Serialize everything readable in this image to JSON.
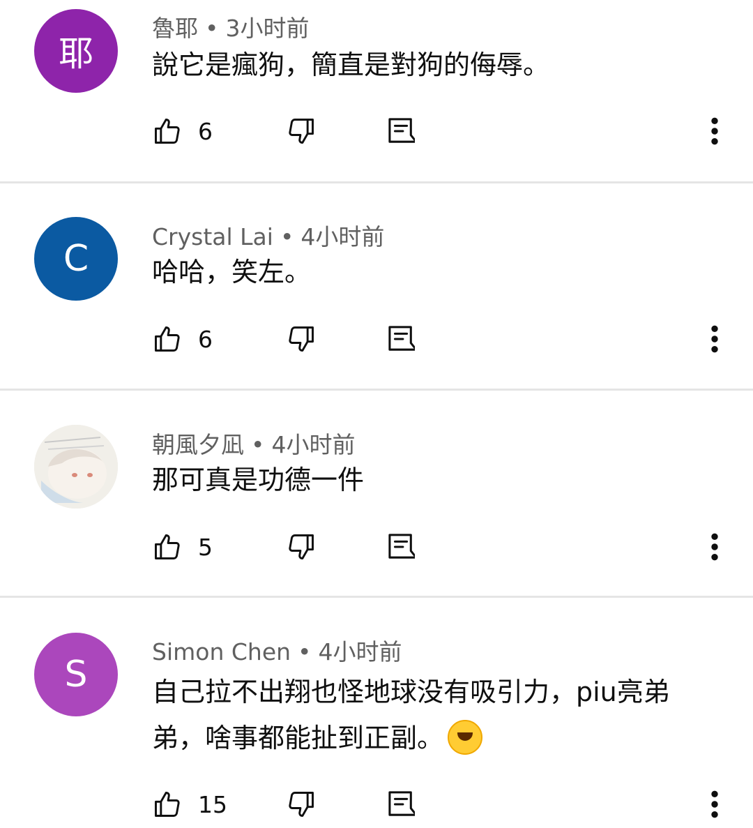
{
  "comments": [
    {
      "author": "魯耶",
      "time": "3小时前",
      "avatar_letter": "耶",
      "avatar_color": "#8e24aa",
      "text": "說它是瘋狗，簡直是對狗的侮辱。",
      "likes": "6"
    },
    {
      "author": "Crystal Lai",
      "time": "4小时前",
      "avatar_letter": "C",
      "avatar_color": "#0b5aa2",
      "text": "哈哈，笑左。",
      "likes": "6"
    },
    {
      "author": "朝風夕凪",
      "time": "4小时前",
      "avatar_letter": "",
      "avatar_color": "#e8e6e2",
      "text": "那可真是功德一件",
      "likes": "5"
    },
    {
      "author": "Simon Chen",
      "time": "4小时前",
      "avatar_letter": "S",
      "avatar_color": "#ab47bc",
      "text_line1": "自己拉不出翔也怪地球没有吸引力，piu亮弟",
      "text_line2": "弟，啥事都能扯到正副。",
      "emoji": "rolling-on-floor-laughing-emoji",
      "likes": "15"
    }
  ],
  "separator": "•"
}
